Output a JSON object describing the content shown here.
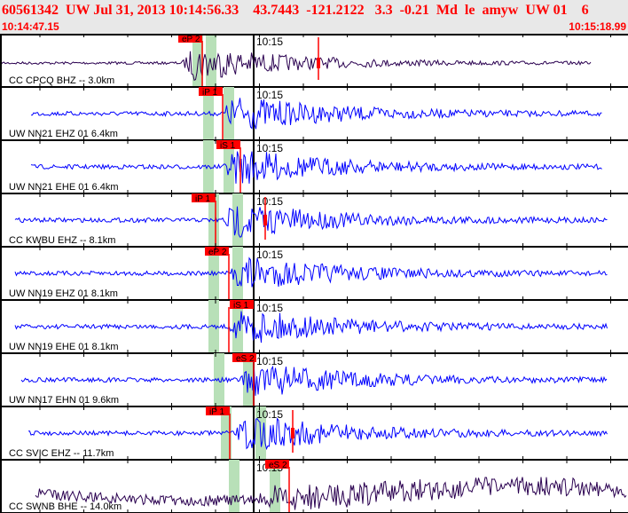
{
  "header": {
    "title": "60561342  UW Jul 31, 2013 10:14:56.33    43.7443  -121.2122   3.3  -0.21  Md  le  amyw  UW 01    6",
    "start_time": "10:14:47.15",
    "end_time": "10:15:18.99"
  },
  "minute_label": "10:15",
  "colors": {
    "trace": "#0000ff",
    "trace_alt": "#2a0050",
    "pick": "#ff0000",
    "window": "#b8e0b8"
  },
  "traces": [
    {
      "station": "CC CPCQ BHZ -- 3.0km",
      "pick": "eP 2",
      "alt": true
    },
    {
      "station": "UW NN21 EHZ 01 6.4km",
      "pick": "iP 1"
    },
    {
      "station": "UW NN21 EHE 01 6.4km",
      "pick": "iS 1"
    },
    {
      "station": "CC KWBU EHZ -- 8.1km",
      "pick": "iP 1"
    },
    {
      "station": "UW NN19 EHZ 01 8.1km",
      "pick": "eP 2"
    },
    {
      "station": "UW NN19 EHE 01 8.1km",
      "pick": "iS 1"
    },
    {
      "station": "UW NN17 EHN 01 9.6km",
      "pick": "eS 2"
    },
    {
      "station": "CC SVIC EHZ -- 11.7km",
      "pick": "iP 1"
    },
    {
      "station": "CC SWNB BHE -- 14.0km",
      "pick": "eS 2",
      "alt": true
    }
  ]
}
